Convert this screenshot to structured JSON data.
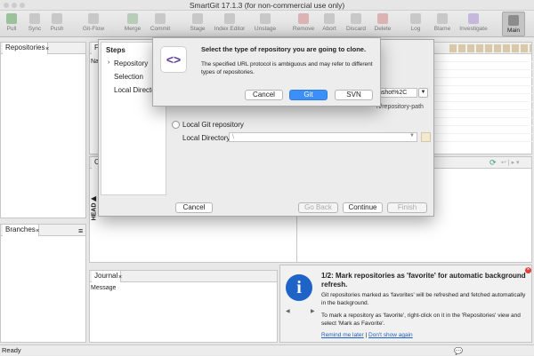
{
  "window": {
    "title": "SmartGit 17.1.3 (for non-commercial use only)"
  },
  "toolbar": {
    "items": [
      {
        "label": "Pull",
        "icon": "pull-icon"
      },
      {
        "label": "Sync",
        "icon": "sync-icon"
      },
      {
        "label": "Push",
        "icon": "push-icon"
      },
      {
        "label": "Git-Flow",
        "icon": "git-flow-icon"
      },
      {
        "label": "Merge",
        "icon": "merge-icon"
      },
      {
        "label": "Commit",
        "icon": "commit-icon"
      },
      {
        "label": "Stage",
        "icon": "stage-icon"
      },
      {
        "label": "Index Editor",
        "icon": "index-editor-icon"
      },
      {
        "label": "Unstage",
        "icon": "unstage-icon"
      },
      {
        "label": "Remove",
        "icon": "remove-icon"
      },
      {
        "label": "Abort",
        "icon": "abort-icon"
      },
      {
        "label": "Discard",
        "icon": "discard-icon"
      },
      {
        "label": "Delete",
        "icon": "delete-icon"
      },
      {
        "label": "Log",
        "icon": "log-icon"
      },
      {
        "label": "Blame",
        "icon": "blame-icon"
      },
      {
        "label": "Investigate",
        "icon": "investigate-icon"
      },
      {
        "label": "Main",
        "icon": "main-perspective-icon"
      }
    ]
  },
  "panels": {
    "repositories": {
      "tab": "Repositories"
    },
    "files": {
      "tab": "File",
      "column": "Nam"
    },
    "changes": {
      "tab": "Ch"
    },
    "branches": {
      "tab": "Branches"
    },
    "journal": {
      "tab": "Journal",
      "column": "Message"
    },
    "head_label": "HEAD"
  },
  "wizard": {
    "steps_title": "Steps",
    "steps": [
      "Repository",
      "Selection",
      "Local Directo"
    ],
    "url_value": "nshot%2C",
    "path_hint": "rt/repository-path",
    "local_option": "Local Git repository",
    "local_dir_label": "Local Directory:",
    "local_dir_value": "\\",
    "buttons": {
      "cancel": "Cancel",
      "back": "Go Back",
      "continue": "Continue",
      "finish": "Finish"
    }
  },
  "type_dialog": {
    "heading": "Select the type of repository you are going to clone.",
    "body": "The specified URL protocol is ambiguous and may refer to different types of repositories.",
    "buttons": {
      "cancel": "Cancel",
      "git": "Git",
      "svn": "SVN"
    }
  },
  "notification": {
    "title": "1/2: Mark repositories as 'favorite' for automatic background refresh.",
    "p1": "Git repositories marked as 'favorites' will be refreshed and fetched automatically in the background.",
    "p2": "To mark a repository as 'favorite', right-click on it in the 'Repositories' view and select 'Mark as Favorite'.",
    "remind": "Remind me later",
    "separator": "|",
    "dont_show": "Don't show again"
  },
  "status": {
    "text": "Ready"
  },
  "colors": {
    "accent": "#3b8ff6",
    "info": "#1e63c8",
    "close": "#e23c3c"
  }
}
